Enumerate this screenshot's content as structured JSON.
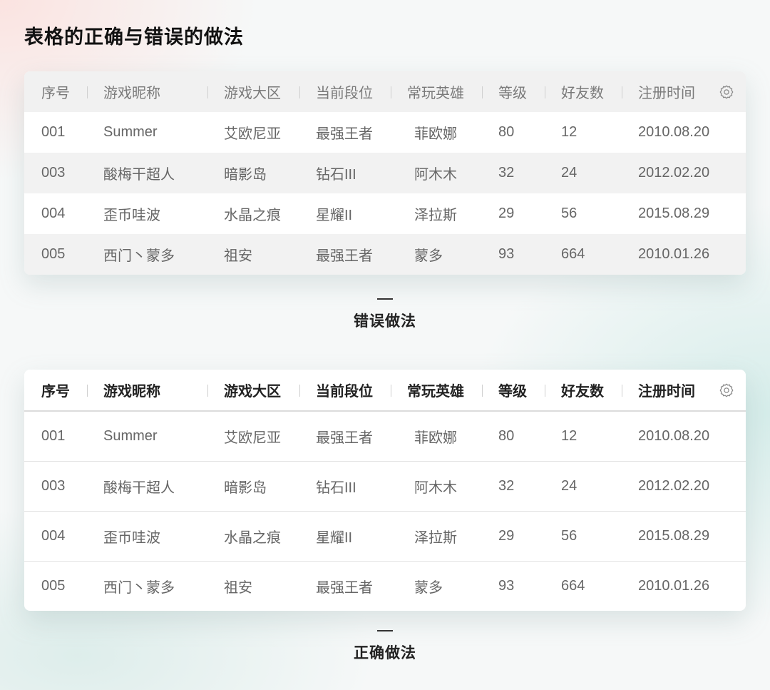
{
  "page": {
    "title": "表格的正确与错误的做法"
  },
  "columns": [
    "序号",
    "游戏昵称",
    "游戏大区",
    "当前段位",
    "常玩英雄",
    "等级",
    "好友数",
    "注册时间"
  ],
  "rows": [
    [
      "001",
      "Summer",
      "艾欧尼亚",
      "最强王者",
      "菲欧娜",
      "80",
      "12",
      "2010.08.20"
    ],
    [
      "003",
      "酸梅干超人",
      "暗影岛",
      "钻石III",
      "阿木木",
      "32",
      "24",
      "2012.02.20"
    ],
    [
      "004",
      "歪币哇波",
      "水晶之痕",
      "星耀II",
      "泽拉斯",
      "29",
      "56",
      "2015.08.29"
    ],
    [
      "005",
      "西门丶蒙多",
      "祖安",
      "最强王者",
      "蒙多",
      "93",
      "664",
      "2010.01.26"
    ]
  ],
  "captions": {
    "wrong": "错误做法",
    "right": "正确做法"
  },
  "icons": {
    "settings": "gear-icon"
  },
  "colors": {
    "header_wrong_bg": "#f1f1f1",
    "row_alt_bg": "#f2f2f2",
    "divider": "#e3e3e3"
  }
}
